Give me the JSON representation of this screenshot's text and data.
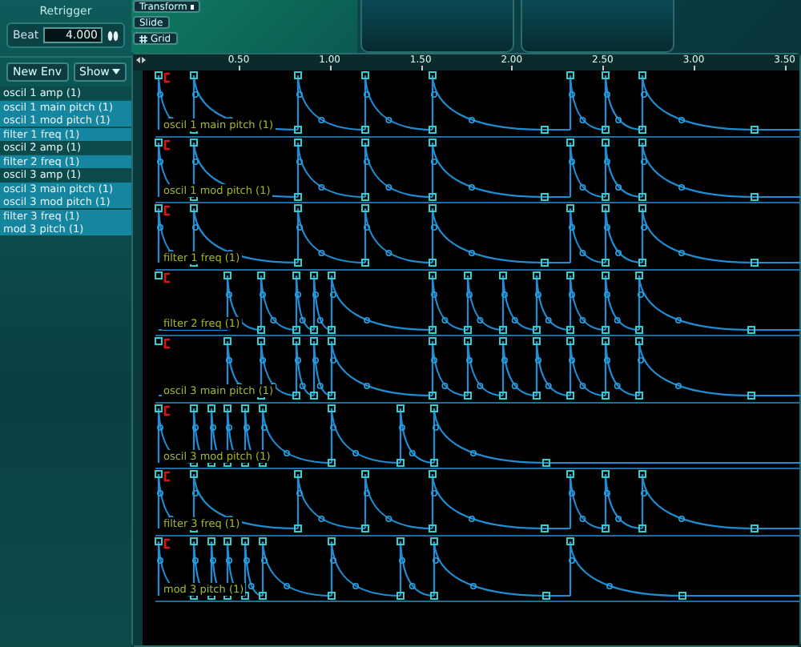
{
  "header": {
    "title": "Retrigger",
    "beat_label": "Beat",
    "beat_value": "4.000"
  },
  "toolbar": {
    "transform": "Transform",
    "slide": "Slide",
    "grid": "Grid"
  },
  "list_buttons": {
    "new_env": "New Env",
    "show": "Show"
  },
  "envelopes": [
    {
      "label": "oscil 1 amp (1)",
      "selected": false
    },
    {
      "label": "oscil 1 main pitch (1)",
      "selected": true
    },
    {
      "label": "oscil 1 mod pitch (1)",
      "selected": true
    },
    {
      "label": "filter 1 freq (1)",
      "selected": true
    },
    {
      "label": "oscil 2 amp (1)",
      "selected": false
    },
    {
      "label": "filter 2 freq (1)",
      "selected": true
    },
    {
      "label": "oscil 3 amp (1)",
      "selected": false
    },
    {
      "label": "oscil 3 main pitch (1)",
      "selected": true
    },
    {
      "label": "oscil 3 mod pitch (1)",
      "selected": true
    },
    {
      "label": "filter 3 freq (1)",
      "selected": true
    },
    {
      "label": "mod 3 pitch (1)",
      "selected": true
    }
  ],
  "ruler": {
    "ticks": [
      "0.50",
      "1.00",
      "1.50",
      "2.00",
      "2.50",
      "3.00",
      "3.50"
    ]
  },
  "lanes": [
    {
      "label": "oscil 1 main pitch (1)"
    },
    {
      "label": "oscil 1 mod pitch (1)"
    },
    {
      "label": "filter 1 freq (1)"
    },
    {
      "label": "filter 2 freq (1)"
    },
    {
      "label": "oscil 3 main pitch (1)"
    },
    {
      "label": "oscil 3 mod pitch (1)"
    },
    {
      "label": "filter 3 freq (1)"
    },
    {
      "label": "mod 3 pitch (1)"
    }
  ]
}
